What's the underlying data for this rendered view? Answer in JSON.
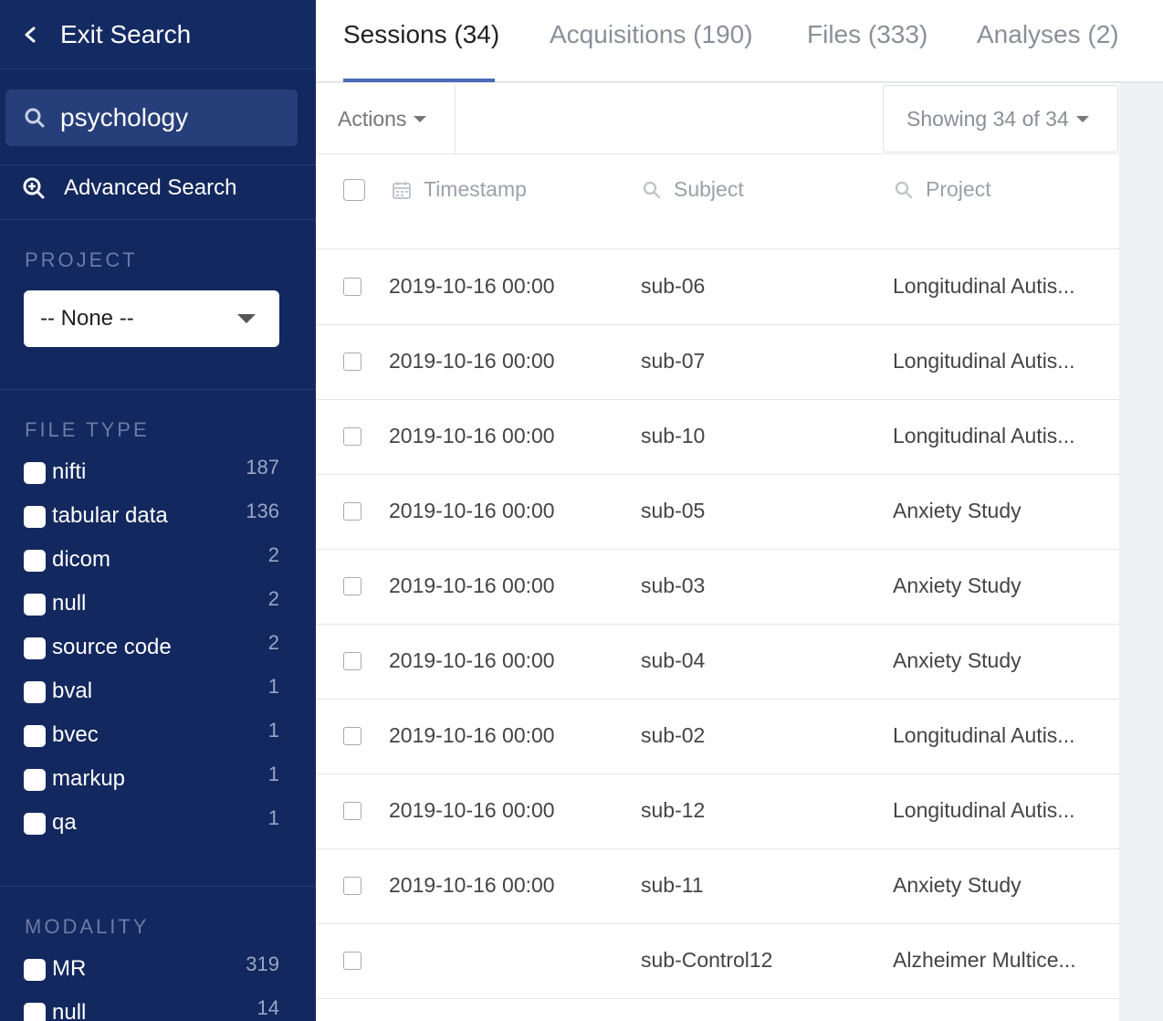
{
  "sidebar": {
    "exit_label": "Exit Search",
    "search_value": "psychology",
    "advanced_label": "Advanced Search",
    "project_title": "PROJECT",
    "project_selected": "-- None --",
    "filetype_title": "FILE TYPE",
    "filetypes": [
      {
        "name": "nifti",
        "count": "187"
      },
      {
        "name": "tabular data",
        "count": "136"
      },
      {
        "name": "dicom",
        "count": "2"
      },
      {
        "name": "null",
        "count": "2"
      },
      {
        "name": "source code",
        "count": "2"
      },
      {
        "name": "bval",
        "count": "1"
      },
      {
        "name": "bvec",
        "count": "1"
      },
      {
        "name": "markup",
        "count": "1"
      },
      {
        "name": "qa",
        "count": "1"
      }
    ],
    "modality_title": "MODALITY",
    "modalities": [
      {
        "name": "MR",
        "count": "319"
      },
      {
        "name": "null",
        "count": "14"
      }
    ]
  },
  "tabs": [
    {
      "label": "Sessions (34)"
    },
    {
      "label": "Acquisitions (190)"
    },
    {
      "label": "Files (333)"
    },
    {
      "label": "Analyses (2)"
    }
  ],
  "toolbar": {
    "actions_label": "Actions",
    "showing_label": "Showing 34 of 34"
  },
  "columns": {
    "timestamp": "Timestamp",
    "subject": "Subject",
    "project": "Project"
  },
  "rows": [
    {
      "timestamp": "2019-10-16 00:00",
      "subject": "sub-06",
      "project": "Longitudinal Autis..."
    },
    {
      "timestamp": "2019-10-16 00:00",
      "subject": "sub-07",
      "project": "Longitudinal Autis..."
    },
    {
      "timestamp": "2019-10-16 00:00",
      "subject": "sub-10",
      "project": "Longitudinal Autis..."
    },
    {
      "timestamp": "2019-10-16 00:00",
      "subject": "sub-05",
      "project": "Anxiety Study"
    },
    {
      "timestamp": "2019-10-16 00:00",
      "subject": "sub-03",
      "project": "Anxiety Study"
    },
    {
      "timestamp": "2019-10-16 00:00",
      "subject": "sub-04",
      "project": "Anxiety Study"
    },
    {
      "timestamp": "2019-10-16 00:00",
      "subject": "sub-02",
      "project": "Longitudinal Autis..."
    },
    {
      "timestamp": "2019-10-16 00:00",
      "subject": "sub-12",
      "project": "Longitudinal Autis..."
    },
    {
      "timestamp": "2019-10-16 00:00",
      "subject": "sub-11",
      "project": "Anxiety Study"
    },
    {
      "timestamp": "",
      "subject": "sub-Control12",
      "project": "Alzheimer Multice..."
    }
  ]
}
